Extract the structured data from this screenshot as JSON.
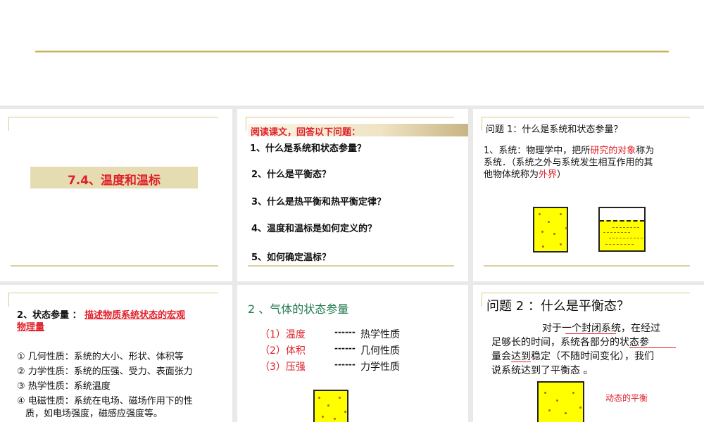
{
  "slides": [
    {
      "title": "7.4、温度和温标"
    },
    {
      "header": "阅读课文，回答以下问题：",
      "questions": [
        "1、什么是系统和状态参量？",
        "2、什么是平衡态？",
        "3、什么是热平衡和热平衡定律？",
        "4、温度和温标是如何定义的？",
        "5、如何确定温标？"
      ]
    },
    {
      "question": "问题 1：什么是系统和状态参量？",
      "line1_a": "1、系统：物理学中，把所",
      "line1_red": "研究的对象",
      "line1_b": "称为",
      "line2": "系统．（系统之外与系统发生相互作用的其",
      "line3_a": "他物体统称为",
      "line3_red": "外界",
      "line3_b": "）"
    },
    {
      "label": "2、状态参量 ：",
      "definition_a": "描述物质系统状态的宏观",
      "definition_b": "物理量",
      "items": [
        "① 几何性质：系统的大小、形状、体积等",
        "② 力学性质：系统的压强、受力、表面张力",
        "③ 热学性质：系统温度",
        "④ 电磁性质：系统在电场、磁场作用下的性",
        "质，如电场强度，磁感应强度等。"
      ]
    },
    {
      "heading": "2 、气体的状态参量",
      "params": [
        {
          "name": "（1）温度",
          "dash": "------",
          "prop": "热学性质"
        },
        {
          "name": "（2）体积",
          "dash": "------",
          "prop": "几何性质"
        },
        {
          "name": "（3）压强",
          "dash": "------",
          "prop": "力学性质"
        }
      ]
    },
    {
      "question": "问题 2 ：什么是平衡态？",
      "p1": "对于一个封闭系统，在经过",
      "p2": "足够长的时间，系统各部分的状态参",
      "p3": "量会达到稳定（不随时间变化），我们",
      "p4": "说系统达到了平衡态 。",
      "note": "动态的平衡"
    }
  ],
  "colors": {
    "accent_red": "#e0202a",
    "green": "#1f7a4d",
    "gold": "#c9b35a",
    "yellow": "#ffff00"
  }
}
